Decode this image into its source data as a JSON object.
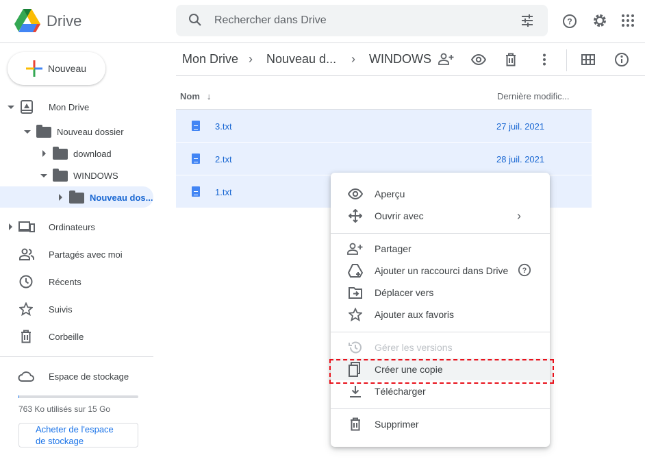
{
  "app": {
    "title": "Drive"
  },
  "search": {
    "placeholder": "Rechercher dans Drive"
  },
  "sidebar": {
    "new_label": "Nouveau",
    "tree": [
      {
        "label": "Mon Drive"
      },
      {
        "label": "Nouveau dossier"
      },
      {
        "label": "download"
      },
      {
        "label": "WINDOWS"
      },
      {
        "label": "Nouveau dos..."
      }
    ],
    "nav": [
      {
        "label": "Ordinateurs"
      },
      {
        "label": "Partagés avec moi"
      },
      {
        "label": "Récents"
      },
      {
        "label": "Suivis"
      },
      {
        "label": "Corbeille"
      }
    ],
    "storage": {
      "label": "Espace de stockage",
      "usage": "763 Ko utilisés sur 15 Go",
      "fraction": 5e-05,
      "buy_label": "Acheter de l'espace de stockage"
    }
  },
  "breadcrumb": [
    "Mon Drive",
    "Nouveau d...",
    "WINDOWS"
  ],
  "list": {
    "col_name": "Nom",
    "col_modified": "Dernière modific...",
    "files": [
      {
        "name": "3.txt",
        "date": "27 juil. 2021"
      },
      {
        "name": "2.txt",
        "date": "28 juil. 2021"
      },
      {
        "name": "1.txt",
        "date": ""
      }
    ]
  },
  "menu": [
    {
      "label": "Aperçu"
    },
    {
      "label": "Ouvrir avec"
    },
    {
      "label": "Partager"
    },
    {
      "label": "Ajouter un raccourci dans Drive"
    },
    {
      "label": "Déplacer vers"
    },
    {
      "label": "Ajouter aux favoris"
    },
    {
      "label": "Gérer les versions"
    },
    {
      "label": "Créer une copie"
    },
    {
      "label": "Télécharger"
    },
    {
      "label": "Supprimer"
    }
  ],
  "colors": {
    "accent": "#1a73e8",
    "selection": "#e8f0fe",
    "highlight_box": "#e8101a"
  }
}
